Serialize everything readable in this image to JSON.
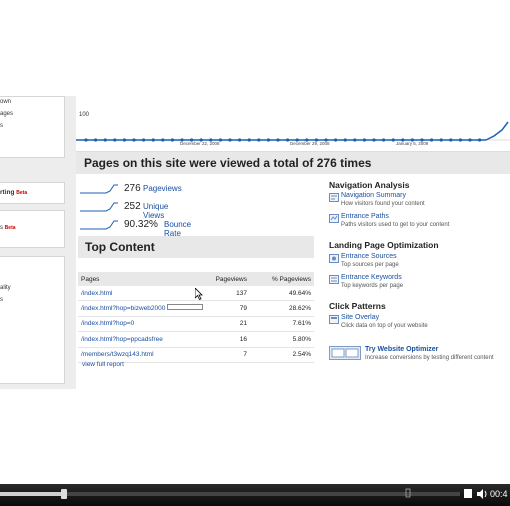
{
  "sidebar": {
    "lines_top": [
      "own",
      "ages",
      "s"
    ],
    "starting": "rting",
    "starting_badge": "Beta",
    "middle_line": "s",
    "middle_badge": "Beta",
    "lines_bottom": [
      "ality",
      "s"
    ]
  },
  "chart": {
    "y_top_label": "100",
    "date_labels": [
      "December 22, 2008",
      "December 29, 2008",
      "January 5, 2009"
    ]
  },
  "summary": {
    "title": "Pages on this site were viewed a total of 276 times"
  },
  "metrics": [
    {
      "value": "276",
      "label": "Pageviews"
    },
    {
      "value": "252",
      "label": "Unique Views"
    },
    {
      "value": "90.32%",
      "label": "Bounce Rate"
    }
  ],
  "top_content": {
    "title": "Top Content",
    "headers": [
      "Pages",
      "Pageviews",
      "% Pageviews"
    ],
    "rows": [
      {
        "page": "/index.html",
        "views": "137",
        "pct": "49.64%"
      },
      {
        "page": "/index.html?hop=bizweb2000",
        "views": "79",
        "pct": "28.62%"
      },
      {
        "page": "/index.html?hop=0",
        "views": "21",
        "pct": "7.61%"
      },
      {
        "page": "/index.html?hop=ppcadsfree",
        "views": "16",
        "pct": "5.80%"
      },
      {
        "page": "/members/t3wzq143.html",
        "views": "7",
        "pct": "2.54%"
      }
    ],
    "full_report": "view full report"
  },
  "navigation_analysis": {
    "heading": "Navigation Analysis",
    "items": [
      {
        "link": "Navigation Summary",
        "desc": "How visitors found your content"
      },
      {
        "link": "Entrance Paths",
        "desc": "Paths visitors used to get to your content"
      }
    ]
  },
  "landing_page": {
    "heading": "Landing Page Optimization",
    "items": [
      {
        "link": "Entrance Sources",
        "desc": "Top sources per page"
      },
      {
        "link": "Entrance Keywords",
        "desc": "Top keywords per page"
      }
    ]
  },
  "click_patterns": {
    "heading": "Click Patterns",
    "items": [
      {
        "link": "Site Overlay",
        "desc": "Click data on top of your website"
      }
    ]
  },
  "optimizer": {
    "link": "Try Website Optimizer",
    "desc": "Increase conversions by testing different content"
  },
  "player": {
    "time": "00:4",
    "progress": 0.14,
    "colors": {
      "bar_bg": "#0a0a0a",
      "fill": "#cfcfcf"
    }
  }
}
